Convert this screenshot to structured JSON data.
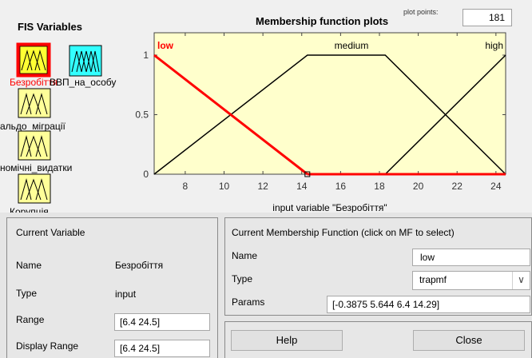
{
  "fis_variables": {
    "title": "FIS Variables",
    "items": [
      {
        "label": "Безробіття",
        "color": "#ff0000"
      },
      {
        "label": "ВВП_на_особу",
        "color": "#000000"
      },
      {
        "label": "альдо_міграції",
        "color": "#000000"
      },
      {
        "label": "номічні_видатки",
        "color": "#000000"
      },
      {
        "label": "Корупція",
        "color": "#000000"
      }
    ]
  },
  "plot": {
    "title": "Membership function plots",
    "points_label": "plot points:",
    "points_value": "181",
    "xlabel": "input variable \"Безробіття\"",
    "mf_labels": [
      "low",
      "medium",
      "high"
    ]
  },
  "chart_data": {
    "type": "line",
    "title": "Membership function plots",
    "xlabel": "input variable \"Безробіття\"",
    "ylabel": "",
    "xlim": [
      6.4,
      24.5
    ],
    "ylim": [
      0,
      1
    ],
    "xticks": [
      "8",
      "10",
      "12",
      "14",
      "16",
      "18",
      "20",
      "22",
      "24"
    ],
    "yticks": [
      "0",
      "0.5",
      "1"
    ],
    "series": [
      {
        "name": "low",
        "color": "#ff0000",
        "x": [
          6.4,
          14.29
        ],
        "y": [
          1,
          0
        ],
        "selected": true
      },
      {
        "name": "medium",
        "color": "#000000",
        "x": [
          6.4,
          14.29,
          18.3,
          24.5
        ],
        "y": [
          0,
          1,
          1,
          0
        ]
      },
      {
        "name": "high",
        "color": "#000000",
        "x": [
          18.3,
          24.5
        ],
        "y": [
          0,
          1
        ]
      }
    ]
  },
  "current_variable": {
    "title": "Current Variable",
    "name_label": "Name",
    "name_value": "Безробіття",
    "type_label": "Type",
    "type_value": "input",
    "range_label": "Range",
    "range_value": "[6.4 24.5]",
    "display_range_label": "Display Range",
    "display_range_value": "[6.4 24.5]"
  },
  "current_mf": {
    "title": "Current Membership Function (click on MF to select)",
    "name_label": "Name",
    "name_value": "low",
    "type_label": "Type",
    "type_value": "trapmf",
    "params_label": "Params",
    "params_value": "[-0.3875 5.644 6.4 14.29]"
  },
  "buttons": {
    "help": "Help",
    "close": "Close"
  },
  "colors": {
    "plot_bg": "#ffffcc",
    "icon_fill": "#ffff99",
    "icon_fill_selected": "#ffff33",
    "output_icon_fill": "#33ffff",
    "selected_border": "#ff0000"
  }
}
